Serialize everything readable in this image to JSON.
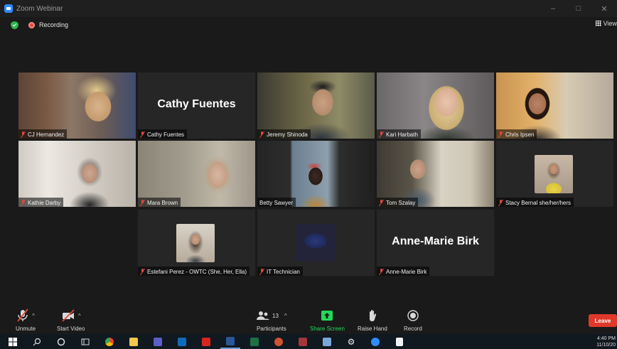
{
  "window": {
    "title": "Zoom Webinar"
  },
  "infobar": {
    "recording_label": "Recording",
    "view_label": "View"
  },
  "participants": [
    {
      "name": "CJ Hernandez",
      "video": true
    },
    {
      "name": "Cathy Fuentes",
      "video": false,
      "display_text": "Cathy Fuentes"
    },
    {
      "name": "Jeremy Shinoda",
      "video": true
    },
    {
      "name": "Kari Harbath",
      "video": true
    },
    {
      "name": "Chris Ipsen",
      "video": true
    },
    {
      "name": "Kathie Darby",
      "video": true
    },
    {
      "name": "Mara Brown",
      "video": true
    },
    {
      "name": "Betty Sawyer",
      "video": true,
      "active_speaker": true
    },
    {
      "name": "Tom Szalay",
      "video": true
    },
    {
      "name": "Stacy Bernal she/her/hers",
      "video": false,
      "avatar": true
    },
    {
      "name": "Estefani Perez - OWTC (She, Her, Ella)",
      "video": false,
      "avatar": true
    },
    {
      "name": "IT Technician",
      "video": false,
      "avatar": true
    },
    {
      "name": "Anne-Marie Birk",
      "video": false,
      "display_text": "Anne-Marie Birk"
    }
  ],
  "controls": {
    "unmute_label": "Unmute",
    "start_video_label": "Start Video",
    "participants_label": "Participants",
    "participants_count": "13",
    "share_screen_label": "Share Screen",
    "raise_hand_label": "Raise Hand",
    "record_label": "Record",
    "leave_label": "Leave"
  },
  "taskbar": {
    "time": "4:40 PM",
    "date": "11/10/20"
  },
  "colors": {
    "accent_green": "#23d959",
    "leave_red": "#e0392b",
    "active_border": "#c6e262",
    "muted_red": "#e0483e"
  }
}
